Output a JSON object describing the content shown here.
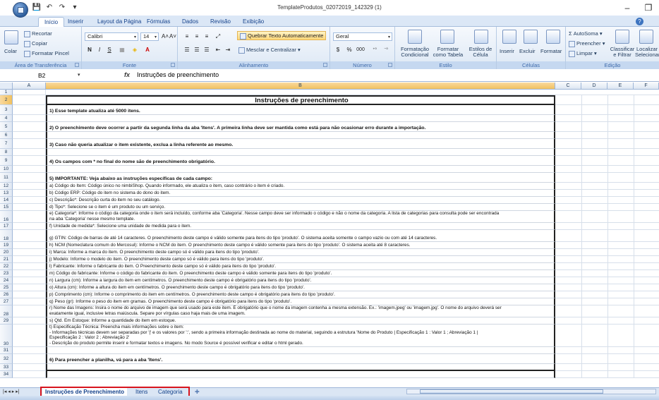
{
  "window": {
    "title": "TemplateProdutos_02072019_142329 (1)",
    "minimize": "–",
    "maximize": "❐"
  },
  "qat": {
    "save": "💾",
    "undo": "↶",
    "redo": "↷",
    "more": "▾"
  },
  "tabs": [
    "Início",
    "Inserir",
    "Layout da Página",
    "Fórmulas",
    "Dados",
    "Revisão",
    "Exibição"
  ],
  "ribbon": {
    "clipboard": {
      "paste": "Colar",
      "cut": "Recortar",
      "copy": "Copiar",
      "format_painter": "Formatar Pincel",
      "title": "Área de Transferência"
    },
    "font": {
      "name": "Calibri",
      "size": "14",
      "grow": "A˄",
      "shrink": "A˅",
      "bold": "N",
      "italic": "I",
      "underline": "S",
      "title": "Fonte"
    },
    "alignment": {
      "wrap": "Quebrar Texto Automaticamente",
      "merge": "Mesclar e Centralizar",
      "title": "Alinhamento"
    },
    "number": {
      "format": "Geral",
      "percent": "%",
      "thousands": "000",
      "title": "Número"
    },
    "styles": {
      "conditional": "Formatação\nCondicional",
      "as_table": "Formatar\ncomo Tabela",
      "cell_styles": "Estilos de\nCélula",
      "title": "Estilo"
    },
    "cells": {
      "insert": "Inserir",
      "delete": "Excluir",
      "format": "Formatar",
      "title": "Células"
    },
    "editing": {
      "autosum": "AutoSoma",
      "fill": "Preencher",
      "clear": "Limpar",
      "sort": "Classificar\ne Filtrar",
      "find": "Localizar\nSelecionar",
      "title": "Edição"
    }
  },
  "formula_bar": {
    "cell": "B2",
    "fx": "fx",
    "content": "Instruções de preenchimento"
  },
  "columns": [
    "A",
    "B",
    "C",
    "D",
    "E",
    "F"
  ],
  "rows": [
    {
      "n": "2",
      "style": "title",
      "lines": [
        "Instruções de preenchimento"
      ]
    },
    {
      "n": "3",
      "style": "bold",
      "lines": [
        "1) Esse template atualiza até 5000 itens."
      ]
    },
    {
      "n": "4",
      "style": "",
      "lines": [
        ""
      ]
    },
    {
      "n": "5",
      "style": "bold",
      "lines": [
        "2) O preenchimento deve ocorrer a partir da segunda linha da aba 'Itens'. A primeira linha deve ser mantida como está para não ocasionar erro durante a importação."
      ]
    },
    {
      "n": "6",
      "style": "",
      "lines": [
        ""
      ]
    },
    {
      "n": "7",
      "style": "bold",
      "lines": [
        "3) Caso não queria atualizar o item existente, exclua a linha referente ao mesmo."
      ]
    },
    {
      "n": "8",
      "style": "",
      "lines": [
        ""
      ]
    },
    {
      "n": "9",
      "style": "bold",
      "lines": [
        "4) Os campos com * no final do nome são de preenchimento obrigatório."
      ]
    },
    {
      "n": "10",
      "style": "",
      "lines": [
        ""
      ]
    },
    {
      "n": "11",
      "style": "bold",
      "lines": [
        "5) IMPORTANTE: Veja abaixo as instruções específicas de cada campo:"
      ]
    },
    {
      "n": "12",
      "style": "",
      "lines": [
        "a) Código do Item: Código único no nimbiShop. Quando informado, ele atualiza o item, caso contrário o item é criado."
      ]
    },
    {
      "n": "13",
      "style": "",
      "lines": [
        "b) Código ERP: Código do item no sistema do dono do item."
      ]
    },
    {
      "n": "14",
      "style": "",
      "lines": [
        "c) Descrição*: Descrição curta do item no seu catálogo."
      ]
    },
    {
      "n": "15",
      "style": "",
      "lines": [
        "d) Tipo*: Selecione se o item é um produto ou um serviço."
      ]
    },
    {
      "n": "16",
      "style": "",
      "lines": [
        "e) Categoria*: Informe o código da categoria onde o item será incluído, conforme aba 'Categoria'. Nesse campo deve ser informado o código e não o nome da categoria. A lista de categorias para consulta pode ser encontrada",
        "na aba 'Categoria' nesse mesmo template."
      ]
    },
    {
      "n": "17",
      "style": "",
      "lines": [
        "f) Unidade de medida*: Selecione uma unidade de medida para o item."
      ]
    },
    {
      "n": "18",
      "style": "",
      "lines": [
        "",
        "g) GTIN: Código de barras de até 14 caracteres. O preenchimento deste campo é válido somente para itens do tipo 'produto'. O sistema aceita somente o campo vazio ou com até 14 caracteres."
      ]
    },
    {
      "n": "19",
      "style": "",
      "lines": [
        "h) NCM (Nomeclatura comum do Mercosul): Informe o NCM do item. O preenchimento deste campo é válido somente para itens do tipo 'produto'. O sistema aceita até 8 caracteres."
      ]
    },
    {
      "n": "20",
      "style": "",
      "lines": [
        "i) Marca: Informe a marca do item. O preenchimento deste campo só é válido para itens do tipo 'produto'."
      ]
    },
    {
      "n": "21",
      "style": "",
      "lines": [
        "j) Modelo: Informe o modelo do item. O preenchimento deste campo só é válido para itens do tipo 'produto'."
      ]
    },
    {
      "n": "22",
      "style": "",
      "lines": [
        "l) Fabricante: Informe o fabricante do item. O Preenchimento deste campo só é válido para itens do tipo 'produto'."
      ]
    },
    {
      "n": "23",
      "style": "",
      "lines": [
        "m) Código do fabricante: Informe o código do fabricante do item. O preenchimento deste campo é válido somente para itens do tipo 'produto'."
      ]
    },
    {
      "n": "24",
      "style": "",
      "lines": [
        "n) Largura (cm): Informe a largura do item em centímetros. O preenchimento deste campo é obrigatório para itens do tipo 'produto'."
      ]
    },
    {
      "n": "25",
      "style": "",
      "lines": [
        "o) Altura (cm): Informe a altura do item em centímetros. O preenchimento deste campo é obrigatório para itens do tipo 'produto'."
      ]
    },
    {
      "n": "26",
      "style": "",
      "lines": [
        "p) Comprimento (cm): Informe o comprimento do item em centímetros. O preenchimento deste campo é obrigatório para itens do tipo 'produto'."
      ]
    },
    {
      "n": "27",
      "style": "",
      "lines": [
        "q) Peso (gr): Informe o peso do item em gramas. O preenchimento deste campo é obrigatório para itens do tipo 'produto'."
      ]
    },
    {
      "n": "28",
      "style": "",
      "lines": [
        "r) Nome das Imagens: Insira o nome do arquivo de imagem que será usado para este item. É obrigatório que o nome da imagem contenha a mesma extensão. Ex.: 'imagem.jpeg' ou 'imagem.jpg'. O nome do arquivo deverá ser",
        "exatamente igual, inclusive letras maiúscula. Separe por vírgulas caso haja mais de uma imagem."
      ]
    },
    {
      "n": "29",
      "style": "",
      "lines": [
        "s) Qtd. Em Estoque: Informe a quantidade do item em estoque."
      ]
    },
    {
      "n": "30",
      "style": "",
      "lines": [
        "t) Especificação Técnica: Preencha mais informações sobre o item:",
        "- Informações técnicas devem ser separadas por '|' e os valores por ':', sendo a primeira informação destinada ao nome do material, seguindo a estrutura 'Nome do Produto | Especificação 1 : Valor 1 ; Abreviação 1 |",
        "Especificação 2 : Valor 2 ; Abreviação 2'",
        "- Descrição do produto permite inserir e formatar textos e imagens. No modo Source é possível verificar e editar o html gerado."
      ]
    },
    {
      "n": "31",
      "style": "",
      "lines": [
        ""
      ]
    },
    {
      "n": "32",
      "style": "bold",
      "lines": [
        "6) Para preencher a planilha, vá para a aba 'Itens'."
      ]
    },
    {
      "n": "33",
      "style": "last",
      "lines": [
        ""
      ]
    },
    {
      "n": "34",
      "style": "",
      "lines": [
        ""
      ]
    }
  ],
  "sheet_nav": "|◂  ◂  ▸  ▸|",
  "sheets": [
    "Instruções de Preenchimento",
    "Itens",
    "Categoria"
  ],
  "new_sheet_icon": "✚"
}
